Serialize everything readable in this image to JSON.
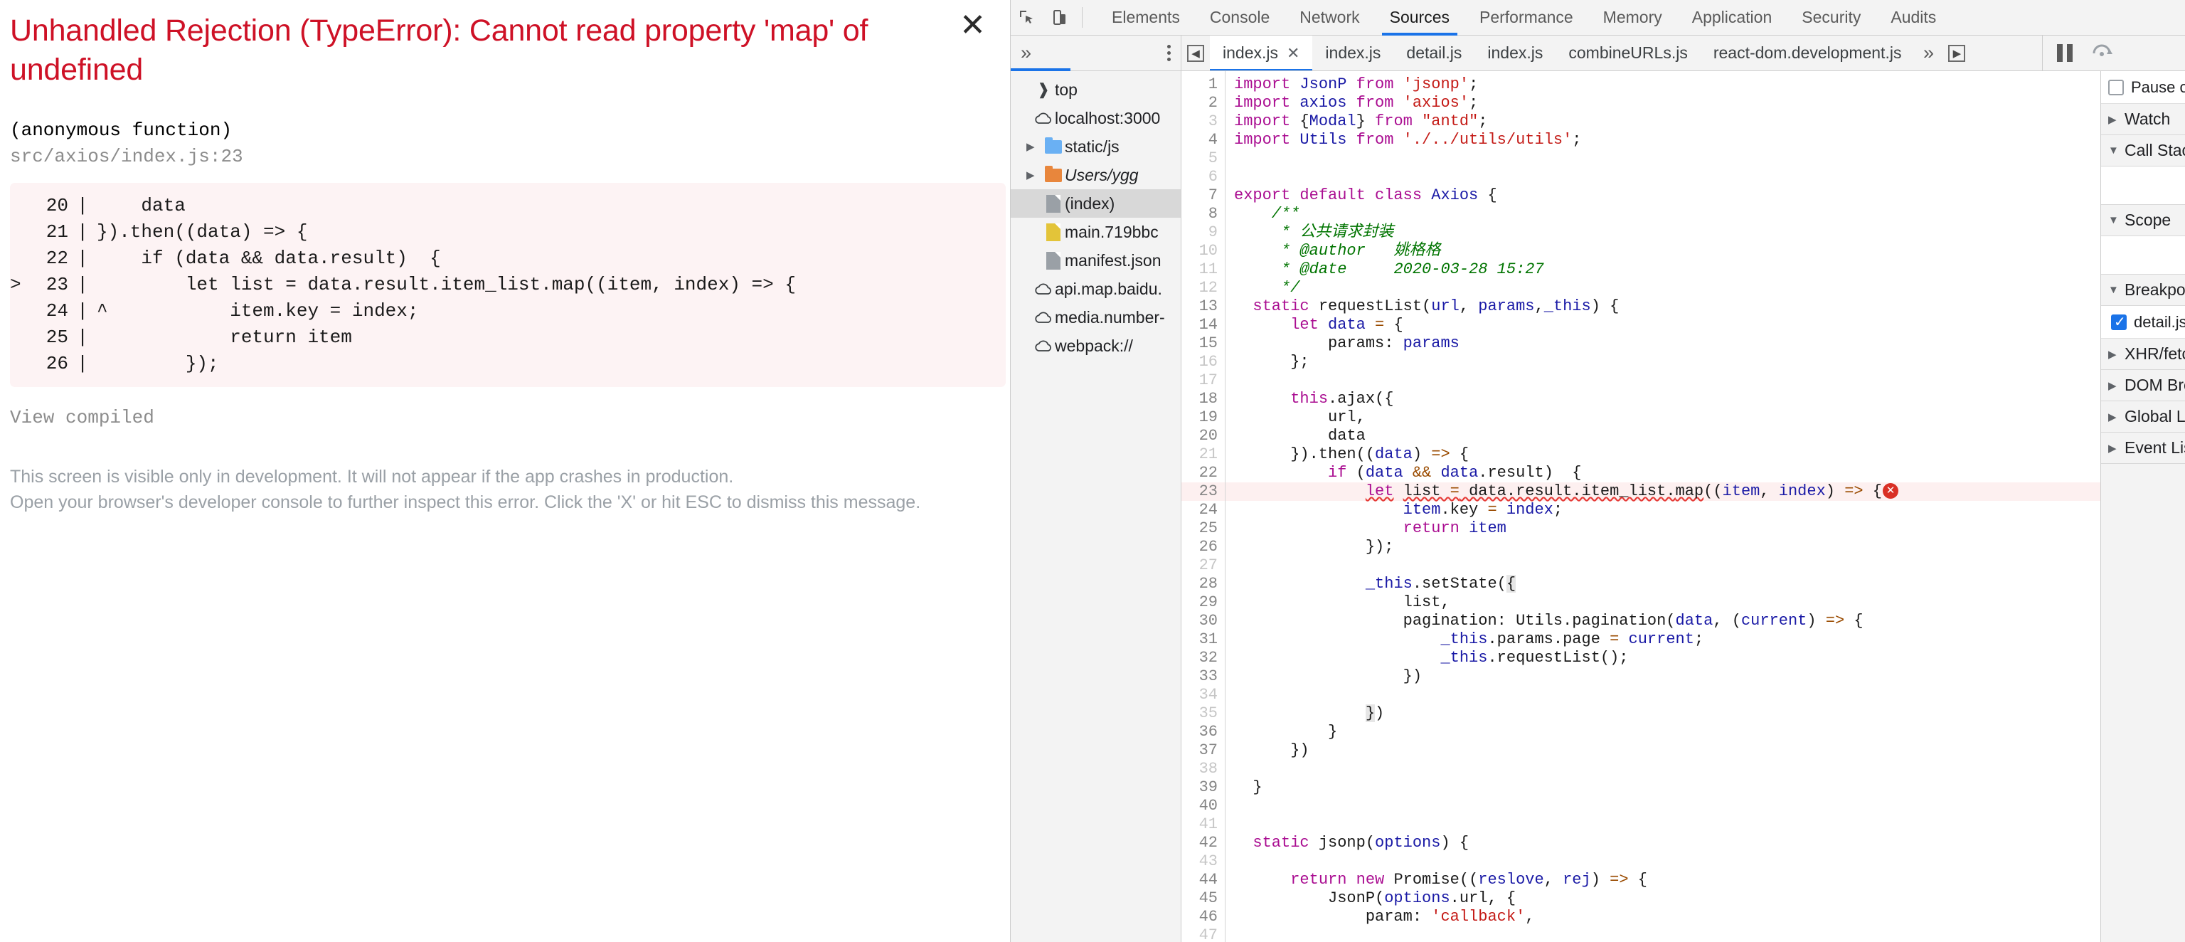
{
  "overlay": {
    "title": "Unhandled Rejection (TypeError): Cannot read property 'map' of undefined",
    "close_label": "✕",
    "frame_function": "(anonymous function)",
    "frame_location": "src/axios/index.js:23",
    "code_frame": [
      {
        "marker": "",
        "num": "20",
        "bar": "|",
        "text": "    data"
      },
      {
        "marker": "",
        "num": "21",
        "bar": "|",
        "text": "}).then((data) => {"
      },
      {
        "marker": "",
        "num": "22",
        "bar": "|",
        "text": "    if (data && data.result)  {"
      },
      {
        "marker": ">",
        "num": "23",
        "bar": "|",
        "text": "        let list = data.result.item_list.map((item, index) => {"
      },
      {
        "marker": "",
        "num": "24",
        "bar": "|",
        "text": "^           item.key = index;"
      },
      {
        "marker": "",
        "num": "25",
        "bar": "|",
        "text": "            return item"
      },
      {
        "marker": "",
        "num": "26",
        "bar": "|",
        "text": "        });"
      }
    ],
    "view_compiled": "View compiled",
    "note_line1": "This screen is visible only in development. It will not appear if the app crashes in production.",
    "note_line2": "Open your browser's developer console to further inspect this error.  Click the 'X' or hit ESC to dismiss this message."
  },
  "devtools": {
    "inspect_icon": "inspect-element-icon",
    "device_icon": "device-toolbar-icon",
    "tabs": [
      {
        "label": "Elements",
        "active": false
      },
      {
        "label": "Console",
        "active": false
      },
      {
        "label": "Network",
        "active": false
      },
      {
        "label": "Sources",
        "active": true
      },
      {
        "label": "Performance",
        "active": false
      },
      {
        "label": "Memory",
        "active": false
      },
      {
        "label": "Application",
        "active": false
      },
      {
        "label": "Security",
        "active": false
      },
      {
        "label": "Audits",
        "active": false
      }
    ],
    "navigator_more": "»",
    "file_tabs": [
      {
        "label": "index.js",
        "active": true,
        "closable": true
      },
      {
        "label": "index.js",
        "active": false,
        "closable": false
      },
      {
        "label": "detail.js",
        "active": false,
        "closable": false
      },
      {
        "label": "index.js",
        "active": false,
        "closable": false
      },
      {
        "label": "combineURLs.js",
        "active": false,
        "closable": false
      },
      {
        "label": "react-dom.development.js",
        "active": false,
        "closable": false
      }
    ],
    "file_tabs_overflow": "»",
    "tree": [
      {
        "label": "top",
        "icon": "frame-icon",
        "arrow": "",
        "indent": 0,
        "selected": false,
        "italic": false
      },
      {
        "label": "localhost:3000",
        "icon": "cloud-icon",
        "arrow": "",
        "indent": 0,
        "selected": false,
        "italic": false
      },
      {
        "label": "static/js",
        "icon": "folder-blue-icon",
        "arrow": "▶",
        "indent": 1,
        "selected": false,
        "italic": false
      },
      {
        "label": "Users/ygg",
        "icon": "folder-orange-icon",
        "arrow": "▶",
        "indent": 1,
        "selected": false,
        "italic": true
      },
      {
        "label": "(index)",
        "icon": "doc-gray-icon",
        "arrow": "",
        "indent": 1,
        "selected": true,
        "italic": false
      },
      {
        "label": "main.719bbc",
        "icon": "doc-yellow-icon",
        "arrow": "",
        "indent": 1,
        "selected": false,
        "italic": false
      },
      {
        "label": "manifest.json",
        "icon": "doc-gray-icon",
        "arrow": "",
        "indent": 1,
        "selected": false,
        "italic": false
      },
      {
        "label": "api.map.baidu.",
        "icon": "cloud-icon",
        "arrow": "",
        "indent": 0,
        "selected": false,
        "italic": false
      },
      {
        "label": "media.number-",
        "icon": "cloud-icon",
        "arrow": "",
        "indent": 0,
        "selected": false,
        "italic": false
      },
      {
        "label": "webpack://",
        "icon": "cloud-icon",
        "arrow": "",
        "indent": 0,
        "selected": false,
        "italic": false
      }
    ],
    "source": [
      {
        "n": 1,
        "dim": false,
        "err": false,
        "html": "<span class=\"k\">import</span> <span class=\"v\">JsonP</span> <span class=\"k\">from</span> <span class=\"s\">'jsonp'</span>;"
      },
      {
        "n": 2,
        "dim": false,
        "err": false,
        "html": "<span class=\"k\">import</span> <span class=\"v\">axios</span> <span class=\"k\">from</span> <span class=\"s\">'axios'</span>;"
      },
      {
        "n": 3,
        "dim": true,
        "err": false,
        "html": "<span class=\"k\">import</span> {<span class=\"v\">Modal</span>} <span class=\"k\">from</span> <span class=\"s\">\"antd\"</span>;"
      },
      {
        "n": 4,
        "dim": false,
        "err": false,
        "html": "<span class=\"k\">import</span> <span class=\"v\">Utils</span> <span class=\"k\">from</span> <span class=\"s\">'./../utils/utils'</span>;"
      },
      {
        "n": 5,
        "dim": true,
        "err": false,
        "html": ""
      },
      {
        "n": 6,
        "dim": true,
        "err": false,
        "html": ""
      },
      {
        "n": 7,
        "dim": false,
        "err": false,
        "html": "<span class=\"k\">export default class</span> <span class=\"v\">Axios</span> {"
      },
      {
        "n": 8,
        "dim": false,
        "err": false,
        "html": "    <span class=\"c\">/**</span>"
      },
      {
        "n": 9,
        "dim": true,
        "err": false,
        "html": "     <span class=\"c\">* 公共请求封装</span>"
      },
      {
        "n": 10,
        "dim": true,
        "err": false,
        "html": "     <span class=\"c\">* @author   姚格格</span>"
      },
      {
        "n": 11,
        "dim": true,
        "err": false,
        "html": "     <span class=\"c\">* @date     2020-03-28 15:27</span>"
      },
      {
        "n": 12,
        "dim": true,
        "err": false,
        "html": "     <span class=\"c\">*/</span>"
      },
      {
        "n": 13,
        "dim": false,
        "err": false,
        "html": "  <span class=\"k\">static</span> requestList(<span class=\"v\">url</span>, <span class=\"v\">params</span>,<span class=\"v\">_this</span>) {"
      },
      {
        "n": 14,
        "dim": false,
        "err": false,
        "html": "      <span class=\"k\">let</span> <span class=\"v\">data</span> <span class=\"o\">=</span> {"
      },
      {
        "n": 15,
        "dim": false,
        "err": false,
        "html": "          params: <span class=\"v\">params</span>"
      },
      {
        "n": 16,
        "dim": true,
        "err": false,
        "html": "      };"
      },
      {
        "n": 17,
        "dim": true,
        "err": false,
        "html": ""
      },
      {
        "n": 18,
        "dim": false,
        "err": false,
        "html": "      <span class=\"k\">this</span>.ajax({"
      },
      {
        "n": 19,
        "dim": false,
        "err": false,
        "html": "          url,"
      },
      {
        "n": 20,
        "dim": false,
        "err": false,
        "html": "          data"
      },
      {
        "n": 21,
        "dim": true,
        "err": false,
        "html": "      }).then((<span class=\"v\">data</span>) <span class=\"o\">=&gt;</span> {"
      },
      {
        "n": 22,
        "dim": false,
        "err": false,
        "html": "          <span class=\"k\">if</span> (<span class=\"v\">data</span> <span class=\"o\">&amp;&amp;</span> <span class=\"v\">data</span>.result)  {"
      },
      {
        "n": 23,
        "dim": false,
        "err": true,
        "html": "              <span class=\"k squig\">let</span> <span class=\"squig\">list </span><span class=\"o squig\">=</span><span class=\"squig\"> data.result.item_list.</span><span class=\"squig\">map</span>((<span class=\"v\">item</span>, <span class=\"v\">index</span>) <span class=\"o\">=&gt;</span> {<span class=\"err-dot\">✕</span>"
      },
      {
        "n": 24,
        "dim": false,
        "err": false,
        "html": "                  <span class=\"v\">item</span>.key <span class=\"o\">=</span> <span class=\"v\">index</span>;"
      },
      {
        "n": 25,
        "dim": false,
        "err": false,
        "html": "                  <span class=\"k\">return</span> <span class=\"v\">item</span>"
      },
      {
        "n": 26,
        "dim": false,
        "err": false,
        "html": "              });"
      },
      {
        "n": 27,
        "dim": true,
        "err": false,
        "html": ""
      },
      {
        "n": 28,
        "dim": false,
        "err": false,
        "html": "              <span class=\"v\">_this</span>.setState(<span class=\"hl\">{</span>"
      },
      {
        "n": 29,
        "dim": false,
        "err": false,
        "html": "                  list,"
      },
      {
        "n": 30,
        "dim": false,
        "err": false,
        "html": "                  pagination: Utils.pagination(<span class=\"v\">data</span>, (<span class=\"v\">current</span>) <span class=\"o\">=&gt;</span> {"
      },
      {
        "n": 31,
        "dim": false,
        "err": false,
        "html": "                      <span class=\"v\">_this</span>.params.page <span class=\"o\">=</span> <span class=\"v\">current</span>;"
      },
      {
        "n": 32,
        "dim": false,
        "err": false,
        "html": "                      <span class=\"v\">_this</span>.requestList();"
      },
      {
        "n": 33,
        "dim": false,
        "err": false,
        "html": "                  })"
      },
      {
        "n": 34,
        "dim": true,
        "err": false,
        "html": ""
      },
      {
        "n": 35,
        "dim": true,
        "err": false,
        "html": "              <span class=\"hl\">}</span>)"
      },
      {
        "n": 36,
        "dim": false,
        "err": false,
        "html": "          }"
      },
      {
        "n": 37,
        "dim": false,
        "err": false,
        "html": "      })"
      },
      {
        "n": 38,
        "dim": true,
        "err": false,
        "html": ""
      },
      {
        "n": 39,
        "dim": false,
        "err": false,
        "html": "  }"
      },
      {
        "n": 40,
        "dim": false,
        "err": false,
        "html": ""
      },
      {
        "n": 41,
        "dim": true,
        "err": false,
        "html": ""
      },
      {
        "n": 42,
        "dim": false,
        "err": false,
        "html": "  <span class=\"k\">static</span> jsonp(<span class=\"v\">options</span>) {"
      },
      {
        "n": 43,
        "dim": true,
        "err": false,
        "html": ""
      },
      {
        "n": 44,
        "dim": false,
        "err": false,
        "html": "      <span class=\"k\">return new</span> Promise((<span class=\"v\">reslove</span>, <span class=\"v\">rej</span>) <span class=\"o\">=&gt;</span> {"
      },
      {
        "n": 45,
        "dim": false,
        "err": false,
        "html": "          JsonP(<span class=\"v\">options</span>.url, {"
      },
      {
        "n": 46,
        "dim": false,
        "err": false,
        "html": "              param: <span class=\"s\">'callback'</span>,"
      },
      {
        "n": 47,
        "dim": true,
        "err": false,
        "html": ""
      }
    ],
    "debugger": {
      "pause_icon": "pause-icon",
      "step_over_icon": "step-over-icon",
      "pause_on_exceptions_label": "Pause on",
      "pause_on_exceptions_checked": false,
      "sections": [
        {
          "label": "Watch",
          "expanded": false
        },
        {
          "label": "Call Stack",
          "expanded": true
        },
        {
          "label": "Scope",
          "expanded": true
        },
        {
          "label": "Breakpoints",
          "expanded": true
        },
        {
          "label": "XHR/fetch",
          "expanded": false
        },
        {
          "label": "DOM Brea",
          "expanded": false
        },
        {
          "label": "Global Lis",
          "expanded": false
        },
        {
          "label": "Event List",
          "expanded": false
        }
      ],
      "breakpoint_file": "detail.js",
      "breakpoint_checked": true
    }
  },
  "colors": {
    "error_red": "#ce1126",
    "accent_blue": "#1a73e8",
    "code_bg": "#fdf3f4",
    "error_line_bg": "#fdf0f0"
  }
}
